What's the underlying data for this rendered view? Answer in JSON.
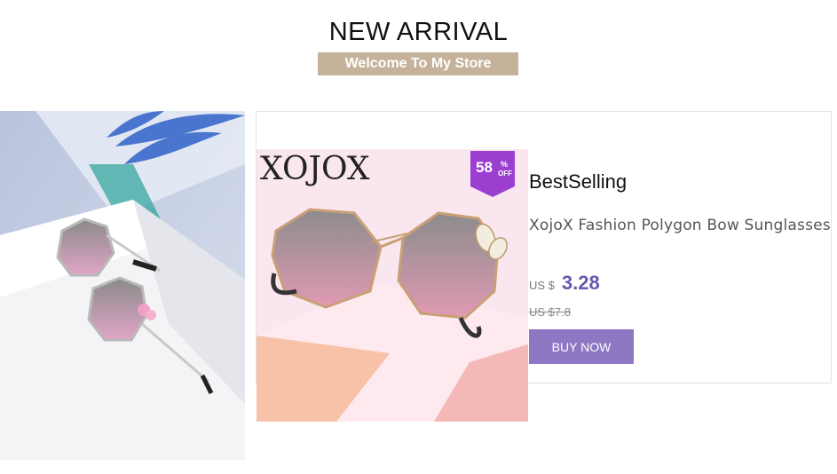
{
  "header": {
    "title": "NEW ARRIVAL",
    "subtitle": "Welcome To My Store"
  },
  "product": {
    "brand_logo": "XOJOX",
    "discount_number": "58",
    "discount_percent": "%",
    "discount_off": "OFF",
    "section_label": "BestSelling",
    "name": "XojoX Fashion Polygon Bow Sunglasses",
    "currency": "US $",
    "price": "3.28",
    "old_price": "US $7.8",
    "buy_label": "BUY NOW"
  },
  "colors": {
    "banner_accent": "#c6b29a",
    "price": "#6a56b0",
    "button": "#8e78c4",
    "badge": "#9b3fd1"
  }
}
